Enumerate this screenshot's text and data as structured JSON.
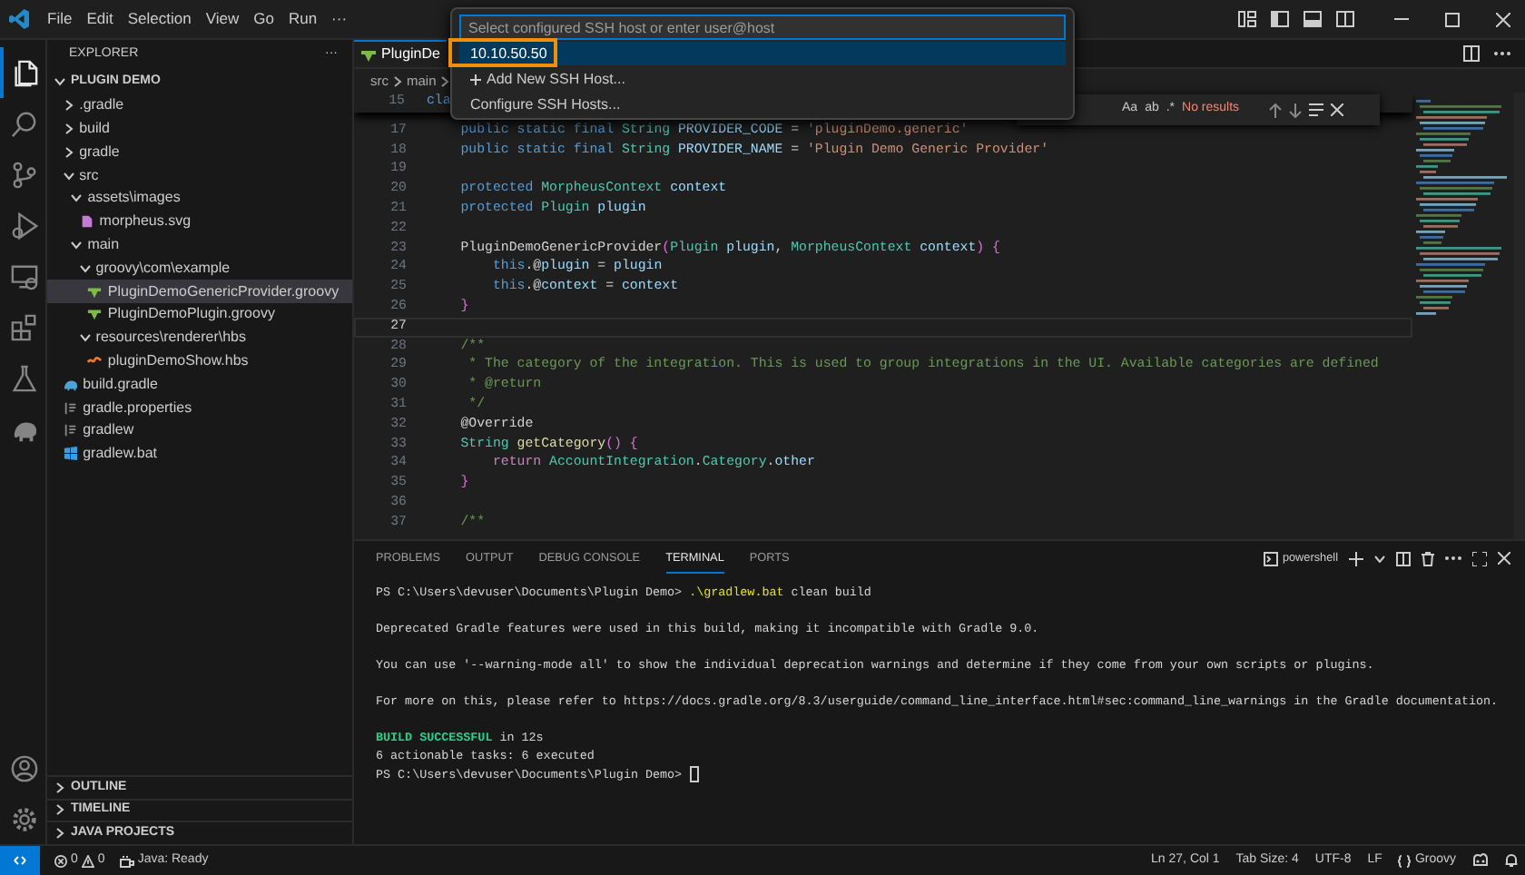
{
  "title_bar": {
    "menu": [
      "File",
      "Edit",
      "Selection",
      "View",
      "Go",
      "Run",
      "···"
    ]
  },
  "activity_bar": {
    "items": [
      {
        "selected": true
      },
      {
        "selected": false
      },
      {
        "selected": false
      },
      {
        "selected": false
      },
      {
        "selected": false
      },
      {
        "selected": false
      },
      {
        "selected": false
      },
      {
        "selected": false
      }
    ]
  },
  "sidebar": {
    "title": "EXPLORER",
    "more": "···",
    "tree": [
      {
        "kind": "folder",
        "label": "PLUGIN DEMO",
        "expanded": true,
        "children": [
          {
            "kind": "folder",
            "label": ".gradle",
            "expanded": false
          },
          {
            "kind": "folder",
            "label": "build",
            "expanded": false
          },
          {
            "kind": "folder",
            "label": "gradle",
            "expanded": false
          },
          {
            "kind": "folder",
            "label": "src",
            "expanded": true,
            "children": [
              {
                "kind": "folder",
                "label": "assets\\images",
                "expanded": true,
                "children": [
                  {
                    "kind": "svg",
                    "label": "morpheus.svg",
                    "selected": false
                  }
                ]
              },
              {
                "kind": "folder",
                "label": "main",
                "expanded": true,
                "children": [
                  {
                    "kind": "folder",
                    "label": "groovy\\com\\example",
                    "expanded": true,
                    "children": [
                      {
                        "kind": "groovy",
                        "label": "PluginDemoGenericProvider.groovy",
                        "selected": true
                      },
                      {
                        "kind": "groovy",
                        "label": "PluginDemoPlugin.groovy",
                        "selected": false
                      }
                    ]
                  },
                  {
                    "kind": "folder",
                    "label": "resources\\renderer\\hbs",
                    "expanded": true,
                    "children": [
                      {
                        "kind": "hbs",
                        "label": "pluginDemoShow.hbs",
                        "selected": false
                      }
                    ]
                  }
                ]
              }
            ]
          },
          {
            "kind": "gradle",
            "label": "build.gradle",
            "selected": false
          },
          {
            "kind": "text",
            "label": "gradle.properties",
            "selected": false
          },
          {
            "kind": "text",
            "label": "gradlew",
            "selected": false
          },
          {
            "kind": "windows",
            "label": "gradlew.bat",
            "selected": false
          }
        ]
      }
    ],
    "sections": [
      {
        "label": "OUTLINE",
        "expanded": false
      },
      {
        "label": "TIMELINE",
        "expanded": false
      },
      {
        "label": "JAVA PROJECTS",
        "expanded": false
      }
    ]
  },
  "editor": {
    "tab": {
      "label": "PluginDe",
      "selected": true
    },
    "breadcrumbs": [
      "src",
      "main"
    ],
    "sticky_line": {
      "number": "15",
      "tokens": [
        {
          "kind": "kw",
          "text": "cla"
        }
      ]
    },
    "lines": [
      {
        "number": "17",
        "current": false,
        "tokens": [
          {
            "kind": "kw",
            "text": "    public static final "
          },
          {
            "kind": "ty",
            "text": "String "
          },
          {
            "kind": "v",
            "text": "PROVIDER_CODE"
          },
          {
            "kind": "p",
            "text": " = "
          },
          {
            "kind": "s",
            "text": "'pluginDemo.generic'"
          }
        ]
      },
      {
        "number": "18",
        "current": false,
        "tokens": [
          {
            "kind": "kw",
            "text": "    public static final "
          },
          {
            "kind": "ty",
            "text": "String "
          },
          {
            "kind": "v",
            "text": "PROVIDER_NAME"
          },
          {
            "kind": "p",
            "text": " = "
          },
          {
            "kind": "s",
            "text": "'Plugin Demo Generic Provider'"
          }
        ]
      },
      {
        "number": "19",
        "current": false
      },
      {
        "number": "20",
        "current": false,
        "tokens": [
          {
            "kind": "kw",
            "text": "    protected "
          },
          {
            "kind": "ty",
            "text": "MorpheusContext "
          },
          {
            "kind": "v",
            "text": "context"
          }
        ]
      },
      {
        "number": "21",
        "current": false,
        "tokens": [
          {
            "kind": "kw",
            "text": "    protected "
          },
          {
            "kind": "ty",
            "text": "Plugin "
          },
          {
            "kind": "v",
            "text": "plugin"
          }
        ]
      },
      {
        "number": "22",
        "current": false
      },
      {
        "number": "23",
        "current": false,
        "tokens": [
          {
            "kind": "p",
            "text": "    PluginDemoGenericProvider"
          },
          {
            "kind": "br",
            "text": "("
          },
          {
            "kind": "ty",
            "text": "Plugin "
          },
          {
            "kind": "v",
            "text": "plugin"
          },
          {
            "kind": "p",
            "text": ", "
          },
          {
            "kind": "ty",
            "text": "MorpheusContext "
          },
          {
            "kind": "v",
            "text": "context"
          },
          {
            "kind": "br",
            "text": ")"
          },
          {
            "kind": "br",
            "text": " {"
          }
        ]
      },
      {
        "number": "24",
        "current": false,
        "tokens": [
          {
            "kind": "kw",
            "text": "        this"
          },
          {
            "kind": "p",
            "text": ".@"
          },
          {
            "kind": "v",
            "text": "plugin"
          },
          {
            "kind": "p",
            "text": " = "
          },
          {
            "kind": "v",
            "text": "plugin"
          }
        ]
      },
      {
        "number": "25",
        "current": false,
        "tokens": [
          {
            "kind": "kw",
            "text": "        this"
          },
          {
            "kind": "p",
            "text": ".@"
          },
          {
            "kind": "v",
            "text": "context"
          },
          {
            "kind": "p",
            "text": " = "
          },
          {
            "kind": "v",
            "text": "context"
          }
        ]
      },
      {
        "number": "26",
        "current": false,
        "tokens": [
          {
            "kind": "br",
            "text": "    }"
          }
        ]
      },
      {
        "number": "27",
        "current": true
      },
      {
        "number": "28",
        "current": false,
        "tokens": [
          {
            "kind": "c",
            "text": "    /**"
          }
        ]
      },
      {
        "number": "29",
        "current": false,
        "tokens": [
          {
            "kind": "c",
            "text": "     * The category of the integration. This is used to group integrations in the UI. Available categories are defined"
          }
        ]
      },
      {
        "number": "30",
        "current": false,
        "tokens": [
          {
            "kind": "c",
            "text": "     * @return"
          }
        ]
      },
      {
        "number": "31",
        "current": false,
        "tokens": [
          {
            "kind": "c",
            "text": "     */"
          }
        ]
      },
      {
        "number": "32",
        "current": false,
        "tokens": [
          {
            "kind": "p",
            "text": "    @Override"
          }
        ]
      },
      {
        "number": "33",
        "current": false,
        "tokens": [
          {
            "kind": "ty",
            "text": "    String "
          },
          {
            "kind": "fn",
            "text": "getCategory"
          },
          {
            "kind": "br",
            "text": "()"
          },
          {
            "kind": "br",
            "text": " {"
          }
        ]
      },
      {
        "number": "34",
        "current": false,
        "tokens": [
          {
            "kind": "ctl",
            "text": "        return "
          },
          {
            "kind": "ty",
            "text": "AccountIntegration"
          },
          {
            "kind": "p",
            "text": "."
          },
          {
            "kind": "ty",
            "text": "Category"
          },
          {
            "kind": "p",
            "text": "."
          },
          {
            "kind": "v",
            "text": "other"
          }
        ]
      },
      {
        "number": "35",
        "current": false,
        "tokens": [
          {
            "kind": "br",
            "text": "    }"
          }
        ]
      },
      {
        "number": "36",
        "current": false
      },
      {
        "number": "37",
        "current": false,
        "tokens": [
          {
            "kind": "c",
            "text": "    /**"
          }
        ]
      }
    ],
    "find_widget": {
      "options": [
        "Aa",
        "ab",
        ".*"
      ],
      "status": "No results"
    }
  },
  "quick_pick": {
    "placeholder": "Select configured SSH host or enter user@host",
    "items": [
      {
        "kind": "host",
        "label": "10.10.50.50",
        "selected": true
      },
      {
        "kind": "add",
        "label": "Add New SSH Host...",
        "selected": false
      },
      {
        "kind": "action",
        "label": "Configure SSH Hosts...",
        "selected": false
      }
    ]
  },
  "panel": {
    "tabs": [
      {
        "label": "PROBLEMS",
        "selected": false
      },
      {
        "label": "OUTPUT",
        "selected": false
      },
      {
        "label": "DEBUG CONSOLE",
        "selected": false
      },
      {
        "label": "TERMINAL",
        "selected": true
      },
      {
        "label": "PORTS",
        "selected": false
      }
    ],
    "shell": "powershell",
    "terminal": [
      {
        "lines": [
          {
            "cursor": false,
            "segments": [
              {
                "kind": "p",
                "text": "PS C:\\Users\\devuser\\Documents\\Plugin Demo> "
              },
              {
                "kind": "cmd",
                "text": ".\\gradlew.bat"
              },
              {
                "kind": "p",
                "text": " clean build"
              }
            ]
          }
        ]
      },
      {
        "lines": [
          {
            "cursor": false,
            "segments": [
              {
                "kind": "p",
                "text": "Deprecated Gradle features were used in this build, making it incompatible with Gradle 9.0."
              }
            ]
          }
        ]
      },
      {
        "lines": [
          {
            "cursor": false,
            "segments": [
              {
                "kind": "p",
                "text": "You can use '--warning-mode all' to show the individual deprecation warnings and determine if they come from your own scripts or plugins."
              }
            ]
          }
        ]
      },
      {
        "lines": [
          {
            "cursor": false,
            "segments": [
              {
                "kind": "p",
                "text": "For more on this, please refer to https://docs.gradle.org/8.3/userguide/command_line_interface.html#sec:command_line_warnings in the Gradle documentation."
              }
            ]
          }
        ]
      },
      {
        "lines": [
          {
            "cursor": false,
            "segments": [
              {
                "kind": "ok",
                "text": "BUILD SUCCESSFUL"
              },
              {
                "kind": "p",
                "text": " in 12s"
              }
            ]
          },
          {
            "cursor": false,
            "segments": [
              {
                "kind": "p",
                "text": "6 actionable tasks: 6 executed"
              }
            ]
          },
          {
            "cursor": true,
            "segments": [
              {
                "kind": "p",
                "text": "PS C:\\Users\\devuser\\Documents\\Plugin Demo> "
              }
            ]
          }
        ]
      }
    ]
  },
  "status_bar": {
    "errors": "0",
    "warnings": "0",
    "java": "Java: Ready",
    "right": [
      "Ln 27, Col 1",
      "Tab Size: 4",
      "UTF-8",
      "LF"
    ],
    "language": "Groovy"
  }
}
